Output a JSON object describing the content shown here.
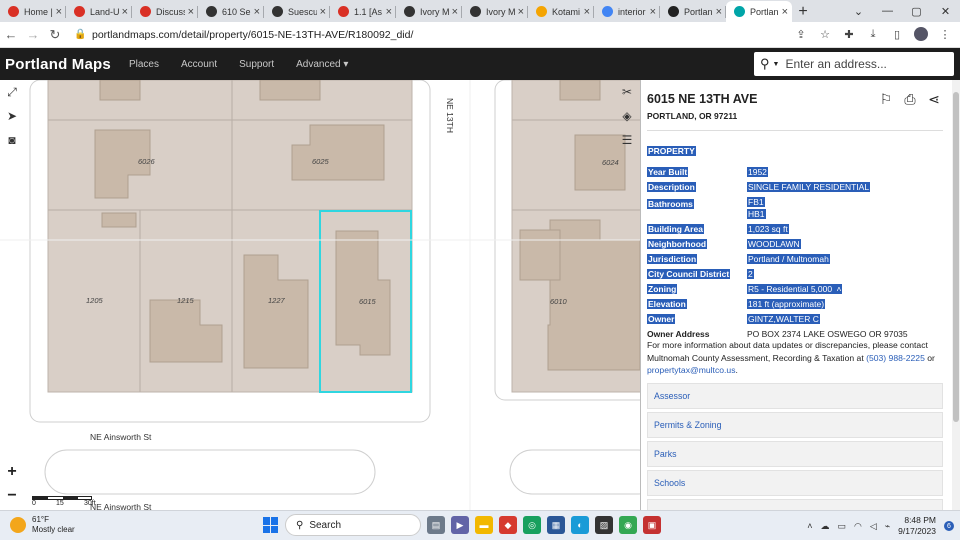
{
  "browser": {
    "tabs": [
      {
        "label": "Home |",
        "color": "#d93025",
        "glyph": "◉"
      },
      {
        "label": "Land-U",
        "color": "#d93025",
        "glyph": "◉"
      },
      {
        "label": "Discuss",
        "color": "#d93025",
        "glyph": "◉"
      },
      {
        "label": "610 Se",
        "color": "#333333",
        "glyph": "◐"
      },
      {
        "label": "Suescu",
        "color": "#333333",
        "glyph": "◐"
      },
      {
        "label": "1.1 [As",
        "color": "#d93025",
        "glyph": "◉"
      },
      {
        "label": "Ivory M",
        "color": "#333333",
        "glyph": "◐"
      },
      {
        "label": "Ivory M",
        "color": "#333333",
        "glyph": "◐"
      },
      {
        "label": "Kotami",
        "color": "#f4a402",
        "glyph": "■"
      },
      {
        "label": "interior",
        "color": "#4285f4",
        "glyph": "G"
      },
      {
        "label": "Portlan",
        "color": "#222222",
        "glyph": "▣"
      },
      {
        "label": "Portlan",
        "color": "#00a5a8",
        "glyph": "⬤",
        "active": true
      }
    ],
    "url": "portlandmaps.com/detail/property/6015-NE-13TH-AVE/R180092_did/"
  },
  "site": {
    "logo": "Portland Maps",
    "nav": [
      "Places",
      "Account",
      "Support",
      "Advanced ▾"
    ],
    "search_placeholder": "Enter an address..."
  },
  "map": {
    "lot_labels": [
      "6026",
      "6025",
      "6024",
      "1205",
      "1215",
      "1227",
      "6015",
      "6010"
    ],
    "streets": [
      "NE Ainsworth St",
      "NE 13TH",
      "NE Ainsworth St"
    ],
    "scale": {
      "a": "0",
      "b": "15",
      "c": "30ft"
    },
    "zoom_in": "+",
    "zoom_out": "−"
  },
  "panel": {
    "address": "6015 NE 13TH AVE",
    "city": "PORTLAND, OR 97211",
    "section": "PROPERTY",
    "rows": [
      {
        "k": "Year Built",
        "v": "1952"
      },
      {
        "k": "Description",
        "v": "SINGLE FAMILY RESIDENTIAL"
      },
      {
        "k": "Bathrooms",
        "v1": "FB1",
        "v2": "HB1"
      },
      {
        "k": "Building Area",
        "v": "1,023 sq ft"
      },
      {
        "k": "Neighborhood",
        "v": "WOODLAWN"
      },
      {
        "k": "Jurisdiction",
        "v": "Portland / Multnomah"
      },
      {
        "k": "City Council District",
        "v": "2"
      },
      {
        "k": "Zoning",
        "v": "R5 - Residential 5,000"
      },
      {
        "k": "Elevation",
        "v": "181 ft (approximate)"
      },
      {
        "k": "Owner",
        "v": "GINTZ,WALTER C"
      },
      {
        "k": "Owner Address",
        "v": "PO BOX 2374 LAKE OSWEGO OR 97035"
      }
    ],
    "note_pre": "For more information about data updates or discrepancies, please contact Multnomah County Assessment, Recording & Taxation at ",
    "note_phone": "(503) 988-2225",
    "note_mid": " or ",
    "note_email": "propertytax@multco.us",
    "note_end": ".",
    "accordions": [
      "Assessor",
      "Permits & Zoning",
      "Parks",
      "Schools"
    ]
  },
  "taskbar": {
    "temp": "61°F",
    "condition": "Mostly clear",
    "search": "Search",
    "time": "8:48 PM",
    "date": "9/17/2023",
    "notifications": "6"
  }
}
